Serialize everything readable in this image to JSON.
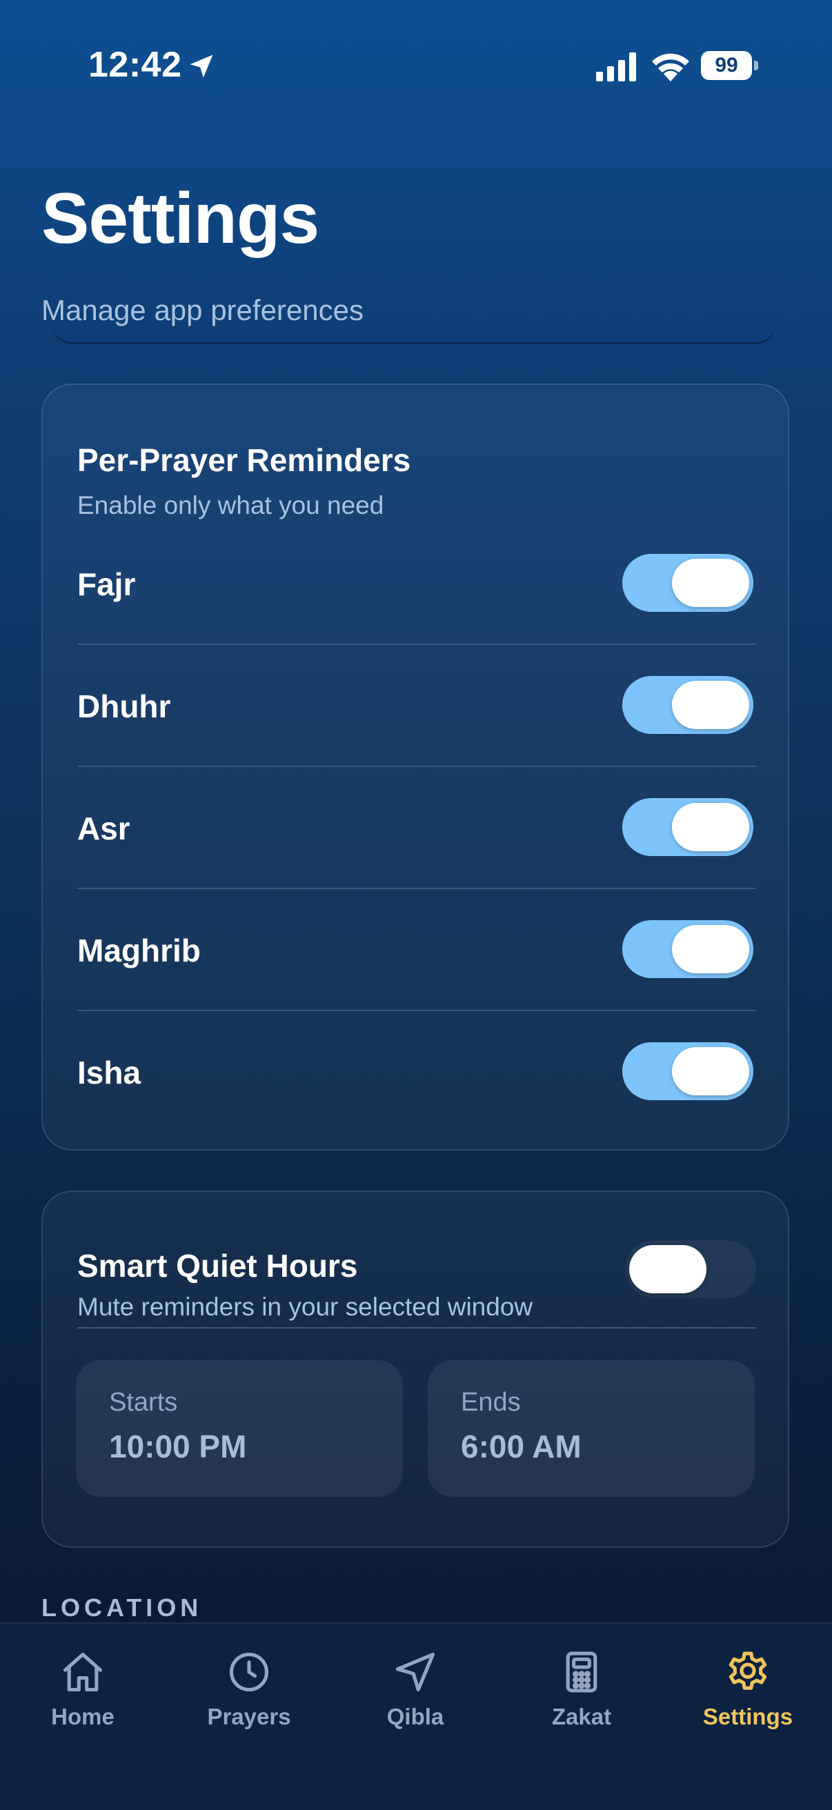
{
  "status_bar": {
    "time": "12:42",
    "battery": "99"
  },
  "header": {
    "title": "Settings",
    "subtitle": "Manage app preferences"
  },
  "reminders": {
    "title": "Per-Prayer Reminders",
    "subtitle": "Enable only what you need",
    "items": [
      {
        "label": "Fajr",
        "enabled": true
      },
      {
        "label": "Dhuhr",
        "enabled": true
      },
      {
        "label": "Asr",
        "enabled": true
      },
      {
        "label": "Maghrib",
        "enabled": true
      },
      {
        "label": "Isha",
        "enabled": true
      }
    ]
  },
  "quiet_hours": {
    "title": "Smart Quiet Hours",
    "subtitle": "Mute reminders in your selected window",
    "enabled": false,
    "starts_label": "Starts",
    "starts_value": "10:00 PM",
    "ends_label": "Ends",
    "ends_value": "6:00 AM"
  },
  "location_section": {
    "header": "LOCATION"
  },
  "tabs": [
    {
      "label": "Home",
      "icon": "home-icon",
      "active": false
    },
    {
      "label": "Prayers",
      "icon": "clock-icon",
      "active": false
    },
    {
      "label": "Qibla",
      "icon": "navigation-arrow-icon",
      "active": false
    },
    {
      "label": "Zakat",
      "icon": "calculator-icon",
      "active": false
    },
    {
      "label": "Settings",
      "icon": "gear-icon",
      "active": true
    }
  ],
  "colors": {
    "accent_toggle": "#7cc4fb",
    "active_tab": "#f2c55c",
    "inactive_tab": "#94a6bf",
    "subtitle_text": "#a8c2e2"
  }
}
